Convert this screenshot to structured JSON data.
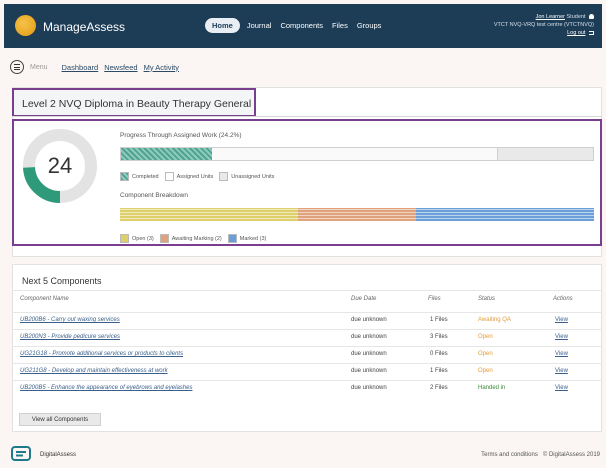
{
  "header": {
    "brand": "ManageAssess",
    "nav": [
      {
        "label": "Home",
        "active": true
      },
      {
        "label": "Journal",
        "active": false
      },
      {
        "label": "Components",
        "active": false
      },
      {
        "label": "Files",
        "active": false
      },
      {
        "label": "Groups",
        "active": false
      }
    ],
    "user_name": "Jon Learner",
    "user_role": "Student",
    "centre": "VTCT NVQ-VRQ test centre (VTCTNVQ)",
    "logout": "Log out",
    "bg_color": "#1d3c56"
  },
  "subnav": {
    "menu_label": "Menu",
    "links": [
      "Dashboard",
      "Newsfeed",
      "My Activity"
    ]
  },
  "page": {
    "title": "Level 2 NVQ Diploma in Beauty Therapy General",
    "progress_value": "24",
    "progress_label": "Progress Through Assigned Work (24.2%)",
    "progress_fraction": 0.242,
    "legend_completed": "Completed",
    "legend_assigned": "Assigned Units",
    "legend_unassigned": "Unassigned Units",
    "breakdown_label": "Component Breakdown",
    "breakdown": [
      {
        "label": "Open (3)",
        "count": 3,
        "color": "#ddd06a"
      },
      {
        "label": "Awaiting Marking (2)",
        "count": 2,
        "color": "#e0a27a"
      },
      {
        "label": "Marked (3)",
        "count": 3,
        "color": "#6a9fd9"
      }
    ],
    "accent_color": "#7a3e8f",
    "completed_color": "#2e9a7a"
  },
  "components": {
    "title": "Next 5 Components",
    "headers": [
      "Component Name",
      "Due Date",
      "Files",
      "Status",
      "Actions"
    ],
    "rows": [
      {
        "name": "UB200B6 - Carry out waxing services",
        "due": "due unknown",
        "files": "1 Files",
        "status": "Awaiting QA",
        "status_type": "qa",
        "action": "View"
      },
      {
        "name": "UB200N3 - Provide pedicure services",
        "due": "due unknown",
        "files": "3 Files",
        "status": "Open",
        "status_type": "open",
        "action": "View"
      },
      {
        "name": "UG21G18 - Promote additional services or products to clients",
        "due": "due unknown",
        "files": "0 Files",
        "status": "Open",
        "status_type": "open",
        "action": "View"
      },
      {
        "name": "UG211G8 - Develop and maintain effectiveness at work",
        "due": "due unknown",
        "files": "1 Files",
        "status": "Open",
        "status_type": "open",
        "action": "View"
      },
      {
        "name": "UB200B5 - Enhance the appearance of eyebrows and eyelashes",
        "due": "due unknown",
        "files": "2 Files",
        "status": "Handed in",
        "status_type": "handed",
        "action": "View"
      }
    ],
    "view_all": "View all Components"
  },
  "footer": {
    "brand": "DigitalAssess",
    "terms": "Terms and conditions",
    "copyright": "© DigitalAssess 2019"
  }
}
